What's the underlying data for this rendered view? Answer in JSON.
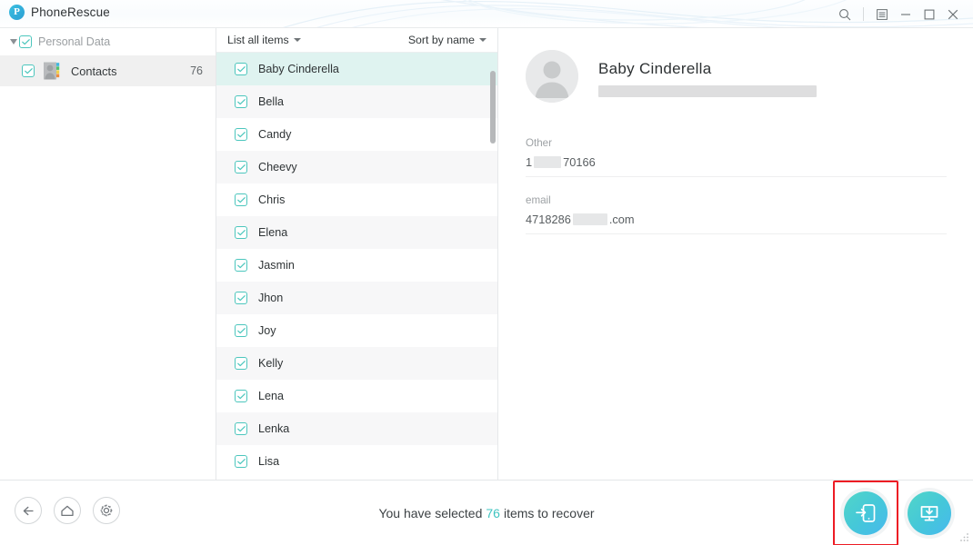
{
  "window": {
    "title": "PhoneRescue",
    "logo_letter": "P",
    "controls": {
      "search": "search-icon",
      "menu": "menu-icon",
      "minimize": "minimize-icon",
      "maximize": "maximize-icon",
      "close": "close-icon"
    }
  },
  "sidebar": {
    "group": {
      "label": "Personal Data",
      "checked": true,
      "expanded": true
    },
    "items": [
      {
        "label": "Contacts",
        "count": "76",
        "checked": true,
        "selected": true
      }
    ]
  },
  "list_panel": {
    "filter_label": "List all items",
    "sort_label": "Sort by name",
    "items": [
      {
        "name": "Baby  Cinderella",
        "checked": true,
        "selected": true
      },
      {
        "name": "Bella",
        "checked": true,
        "selected": false
      },
      {
        "name": "Candy",
        "checked": true,
        "selected": false
      },
      {
        "name": "Cheevy",
        "checked": true,
        "selected": false
      },
      {
        "name": "Chris",
        "checked": true,
        "selected": false
      },
      {
        "name": "Elena",
        "checked": true,
        "selected": false
      },
      {
        "name": "Jasmin",
        "checked": true,
        "selected": false
      },
      {
        "name": "Jhon",
        "checked": true,
        "selected": false
      },
      {
        "name": "Joy",
        "checked": true,
        "selected": false
      },
      {
        "name": "Kelly",
        "checked": true,
        "selected": false
      },
      {
        "name": "Lena",
        "checked": true,
        "selected": false
      },
      {
        "name": "Lenka",
        "checked": true,
        "selected": false
      },
      {
        "name": "Lisa",
        "checked": true,
        "selected": false
      }
    ]
  },
  "detail": {
    "name": "Baby  Cinderella",
    "subtitle_redacted": true,
    "fields": [
      {
        "label": "Other",
        "value_prefix": "1",
        "value_suffix": "70166",
        "redacted": true
      },
      {
        "label": "email",
        "value_prefix": "4718286",
        "value_suffix": ".com",
        "redacted": true
      }
    ]
  },
  "bottom": {
    "nav": [
      {
        "name": "back",
        "glyph": "back-arrow-icon"
      },
      {
        "name": "home",
        "glyph": "home-icon"
      },
      {
        "name": "settings",
        "glyph": "gear-icon"
      }
    ],
    "status_prefix": "You have selected",
    "status_count": "76",
    "status_suffix": "items to recover",
    "actions": [
      {
        "name": "recover-to-device",
        "icon": "phone-export-icon",
        "highlighted": true
      },
      {
        "name": "recover-to-computer",
        "icon": "computer-download-icon",
        "highlighted": false
      }
    ]
  },
  "colors": {
    "accent": "#3ec4c0",
    "selection": "#dff3f0",
    "highlight": "#ed1c24",
    "stripe": "#f7f7f8"
  }
}
